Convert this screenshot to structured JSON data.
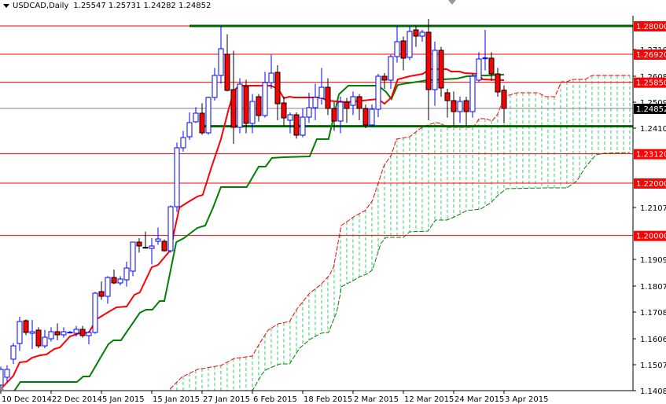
{
  "header": {
    "symbol": "USDCAD,Daily",
    "ohlc": "1.25547 1.25731 1.24282 1.24852"
  },
  "colors": {
    "bull": "#0000ff",
    "bear": "#ff0000",
    "tenkan": "#ff0000",
    "kijun": "#008000",
    "spanA": "#ff0000",
    "spanB": "#008000",
    "cloud": "#2ecc71",
    "level": "#ff0000",
    "support": "#006400",
    "current": "#808080"
  },
  "chart_data": {
    "type": "candlestick",
    "title": "USDCAD,Daily",
    "ylim": [
      1.1408,
      1.286
    ],
    "y_ticks": [
      "1.27100",
      "1.26080",
      "1.25090",
      "1.24100",
      "1.21070",
      "1.19090",
      "1.18070",
      "1.17080",
      "1.16060",
      "1.15070",
      "1.14080"
    ],
    "x_ticks": [
      {
        "bar": 0,
        "label": "10 Dec 2014"
      },
      {
        "bar": 8,
        "label": "22 Dec 2014"
      },
      {
        "bar": 16,
        "label": "5 Jan 2015"
      },
      {
        "bar": 24,
        "label": "15 Jan 2015"
      },
      {
        "bar": 32,
        "label": "27 Jan 2015"
      },
      {
        "bar": 40,
        "label": "6 Feb 2015"
      },
      {
        "bar": 48,
        "label": "18 Feb 2015"
      },
      {
        "bar": 56,
        "label": "2 Mar 2015"
      },
      {
        "bar": 64,
        "label": "12 Mar 2015"
      },
      {
        "bar": 72,
        "label": "24 Mar 2015"
      },
      {
        "bar": 80,
        "label": "3 Apr 2015"
      }
    ],
    "levels": [
      {
        "price": 1.28,
        "label": "1.28000"
      },
      {
        "price": 1.2692,
        "label": "1.26920"
      },
      {
        "price": 1.2585,
        "label": "1.25850"
      },
      {
        "price": 1.2312,
        "label": "1.23120"
      },
      {
        "price": 1.22,
        "label": "1.22000"
      },
      {
        "price": 1.2,
        "label": "1.20000"
      }
    ],
    "current": {
      "price": 1.24852,
      "label": "1.24852"
    },
    "support_lines": [
      {
        "price": 1.28,
        "from_bar": 30
      },
      {
        "price": 1.2417,
        "from_bar": 32
      }
    ],
    "ohlc": [
      [
        1.1429,
        1.15,
        1.14,
        1.1489
      ],
      [
        1.1459,
        1.1505,
        1.144,
        1.1489
      ],
      [
        1.1528,
        1.159,
        1.151,
        1.1579
      ],
      [
        1.1588,
        1.169,
        1.156,
        1.1672
      ],
      [
        1.1675,
        1.168,
        1.162,
        1.163
      ],
      [
        1.1627,
        1.1678,
        1.1567,
        1.1633
      ],
      [
        1.1639,
        1.165,
        1.157,
        1.1579
      ],
      [
        1.1579,
        1.164,
        1.157,
        1.1612
      ],
      [
        1.1606,
        1.165,
        1.1595,
        1.1633
      ],
      [
        1.1633,
        1.1665,
        1.16,
        1.1621
      ],
      [
        1.1621,
        1.165,
        1.161,
        1.1633
      ],
      [
        1.163,
        1.1636,
        1.1627,
        1.1631
      ],
      [
        1.1627,
        1.1655,
        1.1615,
        1.1642
      ],
      [
        1.1642,
        1.1655,
        1.161,
        1.1618
      ],
      [
        1.1618,
        1.1635,
        1.1585,
        1.163
      ],
      [
        1.163,
        1.1785,
        1.1625,
        1.178
      ],
      [
        1.1786,
        1.1825,
        1.1755,
        1.1768
      ],
      [
        1.1768,
        1.1845,
        1.174,
        1.184
      ],
      [
        1.184,
        1.187,
        1.1815,
        1.1819
      ],
      [
        1.1819,
        1.1845,
        1.181,
        1.1834
      ],
      [
        1.1831,
        1.19,
        1.1805,
        1.1876
      ],
      [
        1.1864,
        1.1975,
        1.1845,
        1.1975
      ],
      [
        1.1975,
        1.199,
        1.1935,
        1.196
      ],
      [
        1.1955,
        1.2015,
        1.195,
        1.1954
      ],
      [
        1.1951,
        1.199,
        1.189,
        1.196
      ],
      [
        1.1978,
        1.203,
        1.1965,
        1.1987
      ],
      [
        1.1978,
        1.1985,
        1.1938,
        1.1942
      ],
      [
        1.1942,
        1.2115,
        1.1935,
        1.211
      ],
      [
        1.211,
        1.2355,
        1.209,
        1.2335
      ],
      [
        1.2335,
        1.24,
        1.232,
        1.2374
      ],
      [
        1.2377,
        1.247,
        1.2365,
        1.2431
      ],
      [
        1.2434,
        1.249,
        1.243,
        1.2467
      ],
      [
        1.2467,
        1.2505,
        1.2385,
        1.2392
      ],
      [
        1.2392,
        1.253,
        1.2385,
        1.2527
      ],
      [
        1.2527,
        1.264,
        1.2515,
        1.2611
      ],
      [
        1.2611,
        1.28,
        1.258,
        1.2713
      ],
      [
        1.2692,
        1.2768,
        1.255,
        1.2554
      ],
      [
        1.2557,
        1.2705,
        1.235,
        1.2413
      ],
      [
        1.2413,
        1.26,
        1.239,
        1.2578
      ],
      [
        1.2569,
        1.2595,
        1.239,
        1.2428
      ],
      [
        1.2428,
        1.254,
        1.239,
        1.2512
      ],
      [
        1.253,
        1.254,
        1.2435,
        1.2458
      ],
      [
        1.2458,
        1.2625,
        1.245,
        1.2584
      ],
      [
        1.2584,
        1.269,
        1.256,
        1.262
      ],
      [
        1.2623,
        1.265,
        1.244,
        1.2503
      ],
      [
        1.2506,
        1.253,
        1.242,
        1.2449
      ],
      [
        1.244,
        1.247,
        1.239,
        1.2461
      ],
      [
        1.2461,
        1.247,
        1.237,
        1.2383
      ],
      [
        1.2383,
        1.2485,
        1.2375,
        1.2452
      ],
      [
        1.2452,
        1.2545,
        1.243,
        1.2488
      ],
      [
        1.2488,
        1.258,
        1.244,
        1.2527
      ],
      [
        1.2524,
        1.264,
        1.25,
        1.2566
      ],
      [
        1.2566,
        1.26,
        1.246,
        1.2485
      ],
      [
        1.2485,
        1.251,
        1.24,
        1.2437
      ],
      [
        1.2437,
        1.253,
        1.239,
        1.2509
      ],
      [
        1.2509,
        1.2525,
        1.243,
        1.2485
      ],
      [
        1.2497,
        1.255,
        1.246,
        1.253
      ],
      [
        1.253,
        1.254,
        1.244,
        1.2485
      ],
      [
        1.2485,
        1.25,
        1.241,
        1.2422
      ],
      [
        1.2422,
        1.25,
        1.2415,
        1.2482
      ],
      [
        1.2482,
        1.2617,
        1.2452,
        1.2608
      ],
      [
        1.2608,
        1.262,
        1.256,
        1.2593
      ],
      [
        1.2593,
        1.269,
        1.256,
        1.2683
      ],
      [
        1.2683,
        1.28,
        1.266,
        1.274
      ],
      [
        1.2743,
        1.276,
        1.263,
        1.2677
      ],
      [
        1.268,
        1.28,
        1.267,
        1.2779
      ],
      [
        1.2785,
        1.28,
        1.272,
        1.2761
      ],
      [
        1.2761,
        1.2785,
        1.274,
        1.2776
      ],
      [
        1.2776,
        1.2827,
        1.244,
        1.2557
      ],
      [
        1.2557,
        1.274,
        1.2495,
        1.2707
      ],
      [
        1.2707,
        1.272,
        1.253,
        1.2563
      ],
      [
        1.2545,
        1.256,
        1.245,
        1.2515
      ],
      [
        1.2515,
        1.255,
        1.242,
        1.2473
      ],
      [
        1.2473,
        1.253,
        1.243,
        1.2512
      ],
      [
        1.2515,
        1.253,
        1.242,
        1.2473
      ],
      [
        1.2473,
        1.262,
        1.245,
        1.2608
      ],
      [
        1.2593,
        1.27,
        1.2585,
        1.2674
      ],
      [
        1.2677,
        1.2785,
        1.263,
        1.2678
      ],
      [
        1.2677,
        1.27,
        1.259,
        1.2617
      ],
      [
        1.2617,
        1.264,
        1.253,
        1.2548
      ],
      [
        1.25547,
        1.25731,
        1.24282,
        1.24852
      ]
    ],
    "tenkan": [
      [
        0,
        1.1414
      ],
      [
        2,
        1.1465
      ],
      [
        3,
        1.1516
      ],
      [
        4.1,
        1.1519
      ],
      [
        5,
        1.1534
      ],
      [
        6.25,
        1.1543
      ],
      [
        7.25,
        1.1546
      ],
      [
        8.5,
        1.1567
      ],
      [
        9.4,
        1.1573
      ],
      [
        11,
        1.1615
      ],
      [
        12.5,
        1.1627
      ],
      [
        14,
        1.163
      ],
      [
        15.25,
        1.1681
      ],
      [
        17.1,
        1.1708
      ],
      [
        18.4,
        1.1726
      ],
      [
        20,
        1.1729
      ],
      [
        21.25,
        1.1774
      ],
      [
        22.1,
        1.1783
      ],
      [
        24,
        1.1879
      ],
      [
        25,
        1.1888
      ],
      [
        27.1,
        1.1948
      ],
      [
        27.5,
        1.2008
      ],
      [
        28.4,
        1.2107
      ],
      [
        30,
        1.2131
      ],
      [
        31.25,
        1.2149
      ],
      [
        32.1,
        1.2155
      ],
      [
        33.4,
        1.2254
      ],
      [
        35,
        1.2368
      ],
      [
        36.25,
        1.2485
      ],
      [
        37.1,
        1.2554
      ],
      [
        37.9,
        1.2572
      ],
      [
        42.9,
        1.2572
      ],
      [
        44.1,
        1.256
      ],
      [
        45,
        1.2524
      ],
      [
        45.9,
        1.253
      ],
      [
        46.6,
        1.2527
      ],
      [
        50.9,
        1.2527
      ],
      [
        51.9,
        1.2515
      ],
      [
        55,
        1.2509
      ],
      [
        60,
        1.2521
      ],
      [
        61,
        1.2503
      ],
      [
        62.1,
        1.2527
      ],
      [
        63.1,
        1.2596
      ],
      [
        65,
        1.2608
      ],
      [
        67.1,
        1.2617
      ],
      [
        68.1,
        1.2635
      ],
      [
        70.9,
        1.2635
      ],
      [
        71.6,
        1.2626
      ],
      [
        72.9,
        1.2626
      ],
      [
        73.75,
        1.262
      ],
      [
        75.9,
        1.2617
      ],
      [
        76.6,
        1.2596
      ],
      [
        80,
        1.2593
      ]
    ],
    "kijun": [
      [
        2.1,
        1.1405
      ],
      [
        3.1,
        1.1441
      ],
      [
        12.1,
        1.1441
      ],
      [
        13.1,
        1.1462
      ],
      [
        14.1,
        1.1462
      ],
      [
        17.1,
        1.1585
      ],
      [
        17.9,
        1.16
      ],
      [
        19.1,
        1.16
      ],
      [
        22.1,
        1.1705
      ],
      [
        23.1,
        1.1717
      ],
      [
        24.1,
        1.1717
      ],
      [
        25.25,
        1.175
      ],
      [
        26,
        1.175
      ],
      [
        27.9,
        1.1975
      ],
      [
        29.1,
        1.199
      ],
      [
        31.25,
        1.2029
      ],
      [
        32.5,
        1.2038
      ],
      [
        33.75,
        1.2107
      ],
      [
        35,
        1.2185
      ],
      [
        39.1,
        1.2185
      ],
      [
        41,
        1.2263
      ],
      [
        42.1,
        1.2263
      ],
      [
        43.1,
        1.2296
      ],
      [
        45,
        1.2299
      ],
      [
        49.1,
        1.2302
      ],
      [
        50.25,
        1.2368
      ],
      [
        52.1,
        1.2368
      ],
      [
        53.75,
        1.2539
      ],
      [
        55.25,
        1.2572
      ],
      [
        60,
        1.2572
      ],
      [
        61.25,
        1.2548
      ],
      [
        62.1,
        1.2521
      ],
      [
        63.1,
        1.2575
      ],
      [
        64.6,
        1.2581
      ],
      [
        67.9,
        1.2593
      ],
      [
        72.5,
        1.2599
      ],
      [
        74.1,
        1.2608
      ],
      [
        80,
        1.2614
      ]
    ],
    "span_a": [
      [
        26.9,
        1.1414
      ],
      [
        28.75,
        1.1459
      ],
      [
        31.25,
        1.1489
      ],
      [
        33.4,
        1.1498
      ],
      [
        35,
        1.1504
      ],
      [
        37.1,
        1.1531
      ],
      [
        40,
        1.154
      ],
      [
        40.9,
        1.1579
      ],
      [
        42.5,
        1.1639
      ],
      [
        44.1,
        1.1663
      ],
      [
        45.9,
        1.1672
      ],
      [
        47.1,
        1.172
      ],
      [
        49.1,
        1.178
      ],
      [
        50.9,
        1.1813
      ],
      [
        52.25,
        1.1849
      ],
      [
        52.9,
        1.1879
      ],
      [
        53.75,
        1.199
      ],
      [
        54.1,
        1.2038
      ],
      [
        55.4,
        1.2059
      ],
      [
        56.25,
        1.2074
      ],
      [
        57.9,
        1.2095
      ],
      [
        59.1,
        1.2134
      ],
      [
        60,
        1.22
      ],
      [
        60.9,
        1.2266
      ],
      [
        62.1,
        1.2308
      ],
      [
        62.9,
        1.2368
      ],
      [
        65,
        1.2377
      ],
      [
        66.6,
        1.2407
      ],
      [
        67.5,
        1.2419
      ],
      [
        69.1,
        1.2431
      ],
      [
        70,
        1.2428
      ],
      [
        70.9,
        1.2413
      ],
      [
        75,
        1.2413
      ],
      [
        75.6,
        1.2428
      ],
      [
        76,
        1.2446
      ],
      [
        77.1,
        1.2446
      ],
      [
        78.1,
        1.2437
      ],
      [
        79,
        1.2464
      ],
      [
        80,
        1.253
      ],
      [
        82.1,
        1.2545
      ],
      [
        85.4,
        1.2545
      ],
      [
        86.6,
        1.253
      ],
      [
        88.1,
        1.253
      ],
      [
        89.1,
        1.2587
      ],
      [
        90,
        1.2587
      ],
      [
        90.9,
        1.2596
      ],
      [
        92.9,
        1.2596
      ],
      [
        94,
        1.2611
      ],
      [
        100,
        1.2611
      ]
    ],
    "span_b": [
      [
        26.9,
        1.1384
      ],
      [
        34.6,
        1.1408
      ],
      [
        40,
        1.1408
      ],
      [
        41.6,
        1.1474
      ],
      [
        42.25,
        1.1489
      ],
      [
        44.4,
        1.151
      ],
      [
        45.9,
        1.151
      ],
      [
        47.5,
        1.157
      ],
      [
        49.1,
        1.1603
      ],
      [
        50.9,
        1.1627
      ],
      [
        52.1,
        1.163
      ],
      [
        53.4,
        1.1708
      ],
      [
        54,
        1.178
      ],
      [
        54.1,
        1.1804
      ],
      [
        56,
        1.1828
      ],
      [
        57.1,
        1.1843
      ],
      [
        58.4,
        1.1855
      ],
      [
        59.1,
        1.187
      ],
      [
        60.4,
        1.1969
      ],
      [
        61.25,
        1.1993
      ],
      [
        64,
        1.1993
      ],
      [
        65,
        1.2014
      ],
      [
        67.9,
        1.2017
      ],
      [
        69.1,
        1.2059
      ],
      [
        70.9,
        1.2059
      ],
      [
        72.1,
        1.2071
      ],
      [
        74.1,
        1.2095
      ],
      [
        76.25,
        1.2101
      ],
      [
        77.9,
        1.2125
      ],
      [
        79.1,
        1.2155
      ],
      [
        80.4,
        1.2179
      ],
      [
        86.6,
        1.2182
      ],
      [
        90,
        1.2182
      ],
      [
        91.6,
        1.2209
      ],
      [
        92.9,
        1.226
      ],
      [
        94.6,
        1.2308
      ],
      [
        95.9,
        1.2314
      ],
      [
        100,
        1.2317
      ]
    ]
  }
}
